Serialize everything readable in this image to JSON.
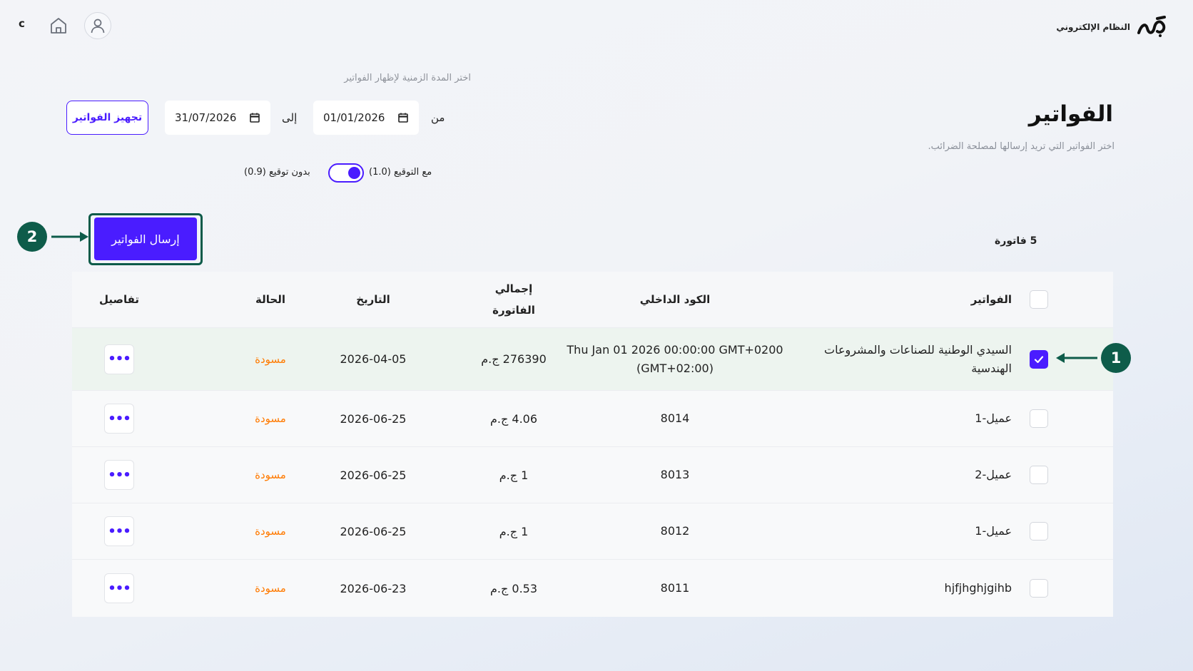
{
  "header": {
    "letter": "c",
    "logo_text": "النظام الإلكتروني",
    "home_icon": "home-icon",
    "user_icon": "user-icon"
  },
  "page": {
    "title": "الفواتير",
    "subtitle": "اختر الفواتير التي تريد إرسالها لمصلحة الضرائب."
  },
  "date_range": {
    "hint": "اختر المدة الزمنية لإظهار الفواتير",
    "from_label": "من",
    "from_value": "01/01/2026",
    "to_label": "إلى",
    "to_value": "31/07/2026",
    "prepare_label": "تجهيز الفواتير"
  },
  "signature_toggle": {
    "with_label": "مع التوقيع (1.0)",
    "without_label": "بدون توقيع (0.9)",
    "on": true
  },
  "send": {
    "label": "إرسال الفواتير",
    "annotation": "2"
  },
  "invoice_count": "5 فاتورة",
  "table": {
    "headers": {
      "invoices": "الفواتير",
      "internal_code": "الكود الداخلي",
      "total_line1": "إجمالي",
      "total_line2": "الفاتورة",
      "date": "التاريخ",
      "status": "الحالة",
      "details": "تفاصيل"
    },
    "rows": [
      {
        "name": "السيدي الوطنية للصناعات والمشروعات الهندسية",
        "code": "Thu Jan 01 2026 00:00:00 GMT+0200 (GMT+02:00)",
        "total": "276390 ج.م",
        "date": "2026-04-05",
        "status": "مسودة",
        "selected": true,
        "annotation": "1"
      },
      {
        "name": "عميل-1",
        "code": "8014",
        "total": "4.06 ج.م",
        "date": "2026-06-25",
        "status": "مسودة",
        "selected": false
      },
      {
        "name": "عميل-2",
        "code": "8013",
        "total": "1 ج.م",
        "date": "2026-06-25",
        "status": "مسودة",
        "selected": false
      },
      {
        "name": "عميل-1",
        "code": "8012",
        "total": "1 ج.م",
        "date": "2026-06-25",
        "status": "مسودة",
        "selected": false
      },
      {
        "name": "hjfjhghjgihb",
        "code": "8011",
        "total": "0.53 ج.م",
        "date": "2026-06-23",
        "status": "مسودة",
        "selected": false
      }
    ]
  },
  "colors": {
    "accent": "#4a1cff",
    "annotation": "#0e5c4a",
    "status_draft": "#ff7a00"
  }
}
